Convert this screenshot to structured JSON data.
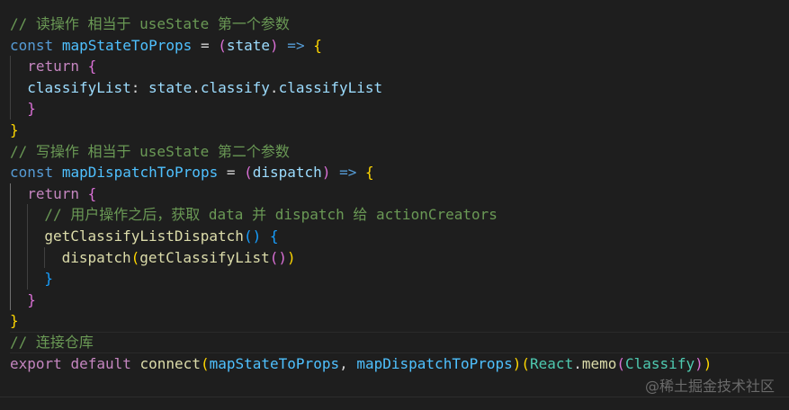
{
  "code": {
    "lines": [
      [
        "// 读操作 相当于 useState 第一个参数"
      ],
      [
        "const",
        "mapStateToProps",
        " = ",
        "(",
        "state",
        ")",
        " => ",
        "{"
      ],
      [
        "return",
        "{"
      ],
      [
        "classifyList",
        ": ",
        "state",
        ".",
        "classify",
        ".",
        "classifyList"
      ],
      [
        "}"
      ],
      [
        "}"
      ],
      [
        "// 写操作 相当于 useState 第二个参数"
      ],
      [
        "const",
        "mapDispatchToProps",
        " = ",
        "(",
        "dispatch",
        ")",
        " => ",
        "{"
      ],
      [
        "return",
        "{"
      ],
      [
        "// 用户操作之后，获取 data 并 dispatch 给 actionCreators"
      ],
      [
        "getClassifyListDispatch",
        "(",
        ")",
        "{"
      ],
      [
        "dispatch",
        "(",
        "getClassifyList",
        "(",
        ")",
        ")"
      ],
      [
        "}"
      ],
      [
        "}"
      ],
      [
        "}"
      ],
      [
        "// 连接仓库"
      ],
      [
        "export",
        "default",
        "connect",
        "(",
        "mapStateToProps",
        ", ",
        "mapDispatchToProps",
        ")",
        "(",
        "React",
        ".",
        "memo",
        "(",
        "Classify",
        ")",
        ")"
      ]
    ]
  },
  "watermark": "@稀土掘金技术社区"
}
